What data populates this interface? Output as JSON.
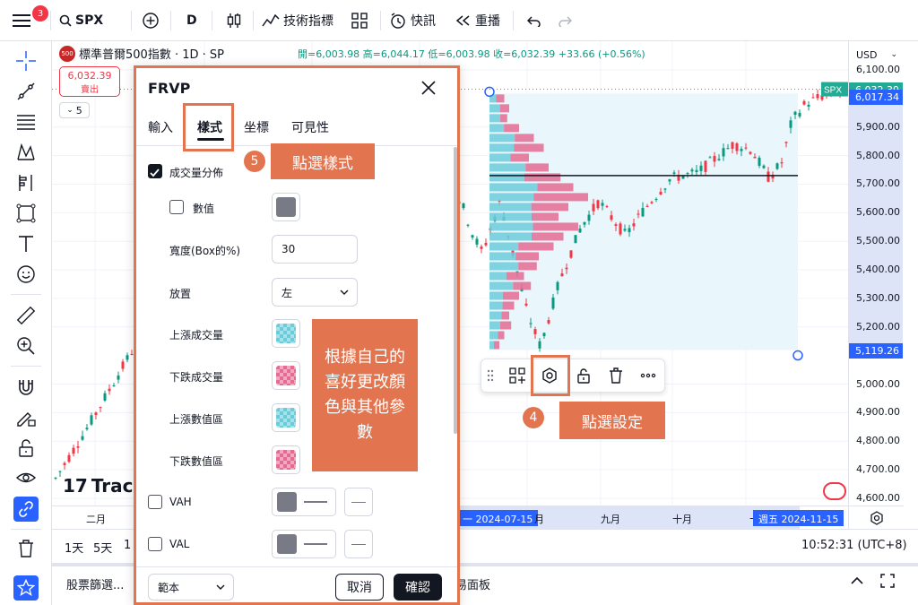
{
  "topbar": {
    "menu_badge": "3",
    "symbol": "SPX",
    "interval": "D",
    "indicators_label": "技術指標",
    "alert_label": "快訊",
    "replay_label": "重播"
  },
  "legend": {
    "symbol_badge": "500",
    "title": "標準普爾500指數 · 1D · SP",
    "ohlc": "開=6,003.98 高=6,044.17 低=6,003.98 收=6,032.39 +33.66 (+0.56%)",
    "sell_price": "6,032.39",
    "sell_label": "賣出",
    "collapse_count": "5"
  },
  "price_axis": {
    "currency": "USD",
    "labels": [
      "6,100.00",
      "5,900.00",
      "5,800.00",
      "5,700.00",
      "5,600.00",
      "5,500.00",
      "5,400.00",
      "5,300.00",
      "5,200.00",
      "5,000.00",
      "4,900.00",
      "4,800.00",
      "4,700.00",
      "4,600.00"
    ],
    "spx_tag": "SPX",
    "spx_price": "6,032.39",
    "range_high": "6,017.34",
    "range_low": "5,119.26",
    "colors": {
      "spx_tag": "#22ab94",
      "range": "#2962ff"
    }
  },
  "time_axis": {
    "labels": [
      "二月",
      "月",
      "九月",
      "十月",
      "十"
    ],
    "range_start": "一 2024-07-15",
    "range_end": "週五 2024-11-15"
  },
  "bottom_bar": {
    "ranges": [
      "1天",
      "5天",
      "1"
    ],
    "clock": "10:52:31 (UTC+8)"
  },
  "panel_bar": {
    "screener": "股票篩選...",
    "trading_panel": "易面板"
  },
  "watermark": "Trac",
  "dialog": {
    "title": "FRVP",
    "tabs": [
      "輸入",
      "樣式",
      "坐標",
      "可見性"
    ],
    "active_tab": "樣式",
    "volume_profile_label": "成交量分佈",
    "values_label": "數值",
    "width_label": "寬度(Box的%)",
    "width_value": "30",
    "placement_label": "放置",
    "placement_value": "左",
    "up_volume_label": "上漲成交量",
    "down_volume_label": "下跌成交量",
    "up_value_area_label": "上漲數值區",
    "down_value_area_label": "下跌數值區",
    "vah_label": "VAH",
    "val_label": "VAL",
    "template_label": "範本",
    "cancel_label": "取消",
    "confirm_label": "確認",
    "colors": {
      "up": "#6ccbd9",
      "down": "#e46b93",
      "line": "#787b86"
    }
  },
  "annotations": {
    "step5_number": "5",
    "step5_text": "點選樣式",
    "step4_number": "4",
    "step4_text": "點選設定",
    "tip_text": "根據自己的喜好更改顏色與其他參數",
    "color": "#e2744f"
  },
  "chart_data": {
    "type": "candlestick",
    "ylim": [
      4600,
      6100
    ],
    "vp_poc": 5730,
    "vp_range": [
      5119.26,
      6017.34
    ]
  }
}
